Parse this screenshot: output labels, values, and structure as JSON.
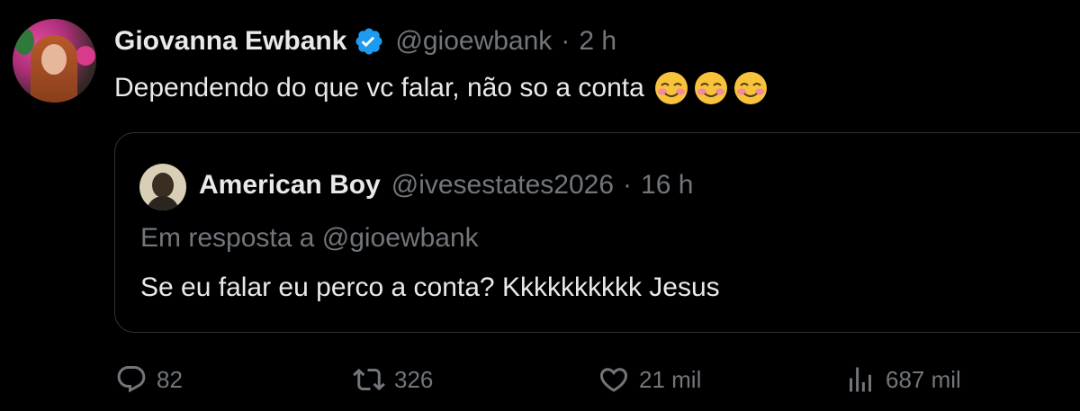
{
  "tweet": {
    "author_name": "Giovanna Ewbank",
    "author_handle": "@gioewbank",
    "separator": "·",
    "time": "2 h",
    "text": "Dependendo do que vc falar, não so a conta",
    "emojis": [
      "smiling-face-with-blush",
      "smiling-face-with-blush",
      "smiling-face-with-blush"
    ]
  },
  "quote": {
    "author_name": "American Boy",
    "author_handle": "@ivesestates2026",
    "separator": "·",
    "time": "16 h",
    "reply_to": "Em resposta a @gioewbank",
    "text": "Se eu falar eu perco a conta? Kkkkkkkkkk Jesus"
  },
  "actions": {
    "replies": "82",
    "retweets": "326",
    "likes": "21 mil",
    "views": "687 mil"
  },
  "colors": {
    "background": "#000000",
    "text": "#e7e9ea",
    "muted": "#71767b",
    "verified": "#1d9bf0",
    "border": "#2f3336"
  }
}
